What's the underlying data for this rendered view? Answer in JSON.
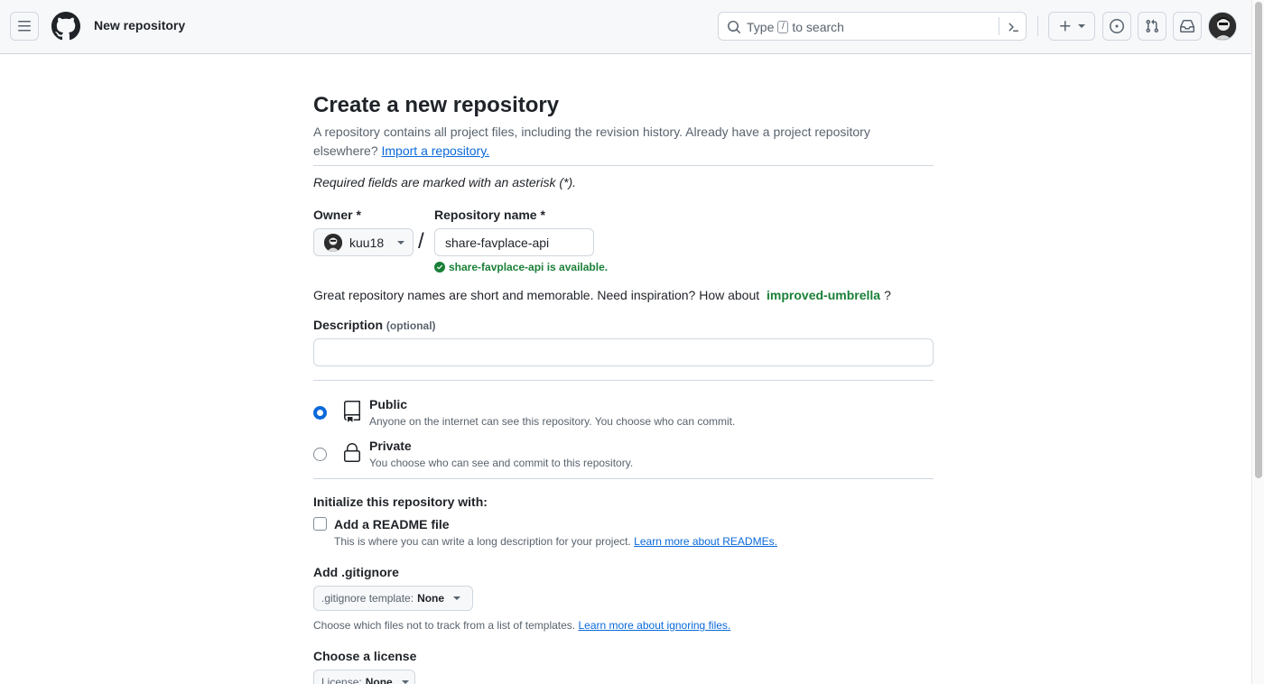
{
  "header": {
    "title": "New repository",
    "search_prefix": "Type",
    "search_key": "/",
    "search_suffix": "to search"
  },
  "page": {
    "title": "Create a new repository",
    "lead_text": "A repository contains all project files, including the revision history. Already have a project repository elsewhere?",
    "import_link": "Import a repository.",
    "required_note": "Required fields are marked with an asterisk (*)."
  },
  "owner": {
    "label": "Owner *",
    "value": "kuu18"
  },
  "repo": {
    "label": "Repository name *",
    "value": "share-favplace-api",
    "availability": "share-favplace-api is available."
  },
  "inspiration": {
    "prefix": "Great repository names are short and memorable. Need inspiration? How about",
    "suggestion": "improved-umbrella",
    "suffix": "?"
  },
  "description": {
    "label": "Description",
    "optional": "(optional)",
    "value": ""
  },
  "visibility": {
    "selected": "public",
    "public_title": "Public",
    "public_desc": "Anyone on the internet can see this repository. You choose who can commit.",
    "private_title": "Private",
    "private_desc": "You choose who can see and commit to this repository."
  },
  "init": {
    "label": "Initialize this repository with:",
    "readme_title": "Add a README file",
    "readme_desc": "This is where you can write a long description for your project.",
    "readme_link": "Learn more about READMEs."
  },
  "gitignore": {
    "label": "Add .gitignore",
    "dropdown_prefix": ".gitignore template:",
    "dropdown_value": "None",
    "help": "Choose which files not to track from a list of templates.",
    "help_link": "Learn more about ignoring files."
  },
  "license": {
    "label": "Choose a license",
    "dropdown_prefix": "License:",
    "dropdown_value": "None"
  },
  "colors": {
    "accent": "#0969da",
    "success": "#1a7f37",
    "header_bg": "#f6f8fa"
  }
}
